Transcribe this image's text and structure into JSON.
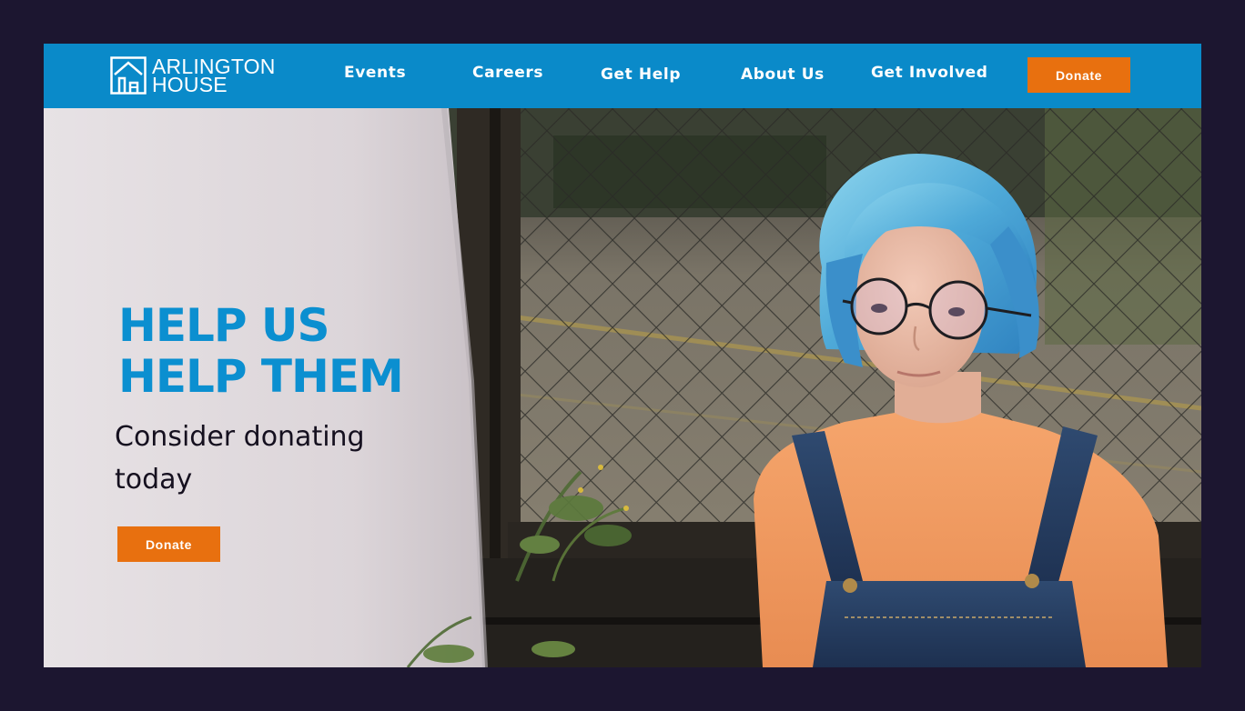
{
  "brand": {
    "line1": "ARLINGTON",
    "line2": "HOUSE",
    "logo_icon": "house-icon"
  },
  "nav": {
    "items": [
      {
        "label": "Events"
      },
      {
        "label": "Careers"
      },
      {
        "label": "Get Help"
      },
      {
        "label": "About Us"
      },
      {
        "label": "Get Involved"
      }
    ],
    "donate_label": "Donate"
  },
  "hero": {
    "headline_line1": "HELP US",
    "headline_line2": "HELP THEM",
    "subheadline": "Consider donating today",
    "cta_label": "Donate",
    "image": "photo-girl-blue-hair-orange-sweater-overalls-by-chain-link-fence"
  },
  "colors": {
    "nav_bg": "#0a8ac9",
    "accent": "#e8700f",
    "headline": "#0b8fd0",
    "page_bg": "#1c1630"
  }
}
